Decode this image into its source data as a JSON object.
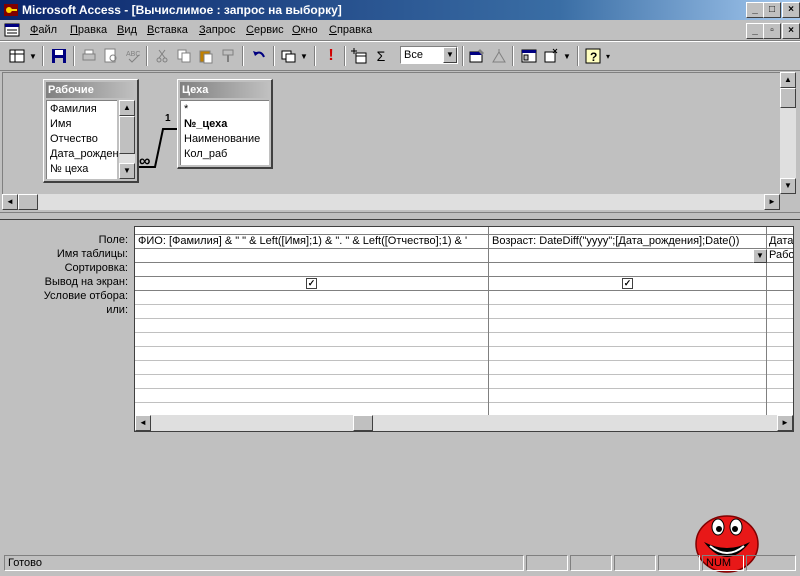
{
  "window": {
    "title": "Microsoft Access - [Вычислимое : запрос на выборку]"
  },
  "menu": [
    {
      "label": "Файл",
      "hot": "Ф",
      "rest": "айл"
    },
    {
      "label": "Правка",
      "hot": "П",
      "rest": "равка"
    },
    {
      "label": "Вид",
      "hot": "В",
      "rest": "ид"
    },
    {
      "label": "Вставка",
      "hot": "В",
      "rest": "ставка"
    },
    {
      "label": "Запрос",
      "hot": "З",
      "rest": "апрос"
    },
    {
      "label": "Сервис",
      "hot": "С",
      "rest": "ервис"
    },
    {
      "label": "Окно",
      "hot": "О",
      "rest": "кно"
    },
    {
      "label": "Справка",
      "hot": "С",
      "rest": "правка"
    }
  ],
  "toolbar": {
    "top_values": "Все",
    "sigma": "Σ",
    "run": "!"
  },
  "tables": {
    "workers": {
      "title": "Рабочие",
      "fields": [
        "Фамилия",
        "Имя",
        "Отчество",
        "Дата_рожден",
        "№ цеха"
      ]
    },
    "workshops": {
      "title": "Цеха",
      "fields": [
        "*",
        "№_цеха",
        "Наименование",
        "Кол_раб"
      ]
    },
    "relation": {
      "one": "1",
      "many": "∞"
    }
  },
  "grid": {
    "row_labels": [
      "Поле:",
      "Имя таблицы:",
      "Сортировка:",
      "Вывод на экран:",
      "Условие отбора:",
      "или:"
    ],
    "columns": [
      {
        "field": "ФИО: [Фамилия] & \" \" & Left([Имя];1) & \". \" & Left([Отчество];1) & '",
        "table": "",
        "show": true
      },
      {
        "field": "Возраст: DateDiff(\"yyyy\";[Дата_рождения];Date())",
        "table": "",
        "show": true
      },
      {
        "field": "Дата",
        "table": "Рабо",
        "show": false
      }
    ],
    "check_mark": "✓"
  },
  "status": {
    "text": "Готово",
    "num": "NUM"
  },
  "colors": {
    "titlebar_start": "#0a246a",
    "face": "#c0c0c0",
    "smiley": "#e81818"
  }
}
